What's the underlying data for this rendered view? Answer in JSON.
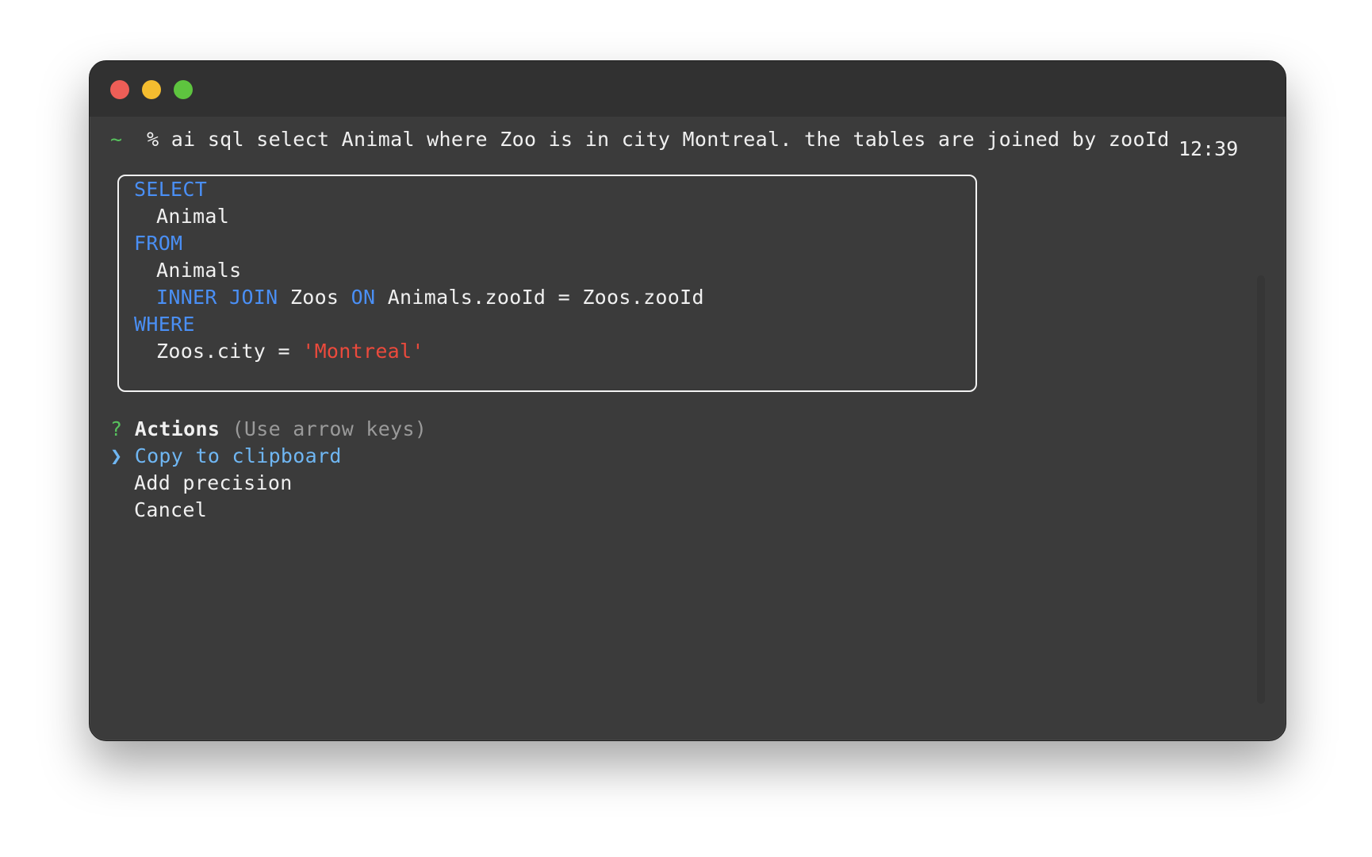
{
  "window": {
    "colors": {
      "background": "#3b3b3b",
      "titlebar": "#313131",
      "keyword": "#4a8ff5",
      "string": "#ec4a3c",
      "prompt": "#57c25d",
      "selected": "#6fb6f2",
      "hint": "#9a9a9a"
    }
  },
  "prompt": {
    "tilde": "~",
    "command": "% ai sql select Animal where Zoo is in city Montreal. the tables are joined by zooId",
    "time": "12:39"
  },
  "sql": {
    "select_kw": "SELECT",
    "select_col": "Animal",
    "from_kw": "FROM",
    "from_table": "Animals",
    "join_kw": "INNER JOIN",
    "join_table": "Zoos",
    "on_kw": "ON",
    "join_condition": "Animals.zooId = Zoos.zooId",
    "where_kw": "WHERE",
    "where_lhs": "Zoos.city = ",
    "where_value": "'Montreal'"
  },
  "actions": {
    "question_mark": "?",
    "title": "Actions",
    "hint": "(Use arrow keys)",
    "pointer": "❯",
    "items": [
      {
        "label": "Copy to clipboard",
        "selected": true
      },
      {
        "label": "Add precision",
        "selected": false
      },
      {
        "label": "Cancel",
        "selected": false
      }
    ]
  }
}
